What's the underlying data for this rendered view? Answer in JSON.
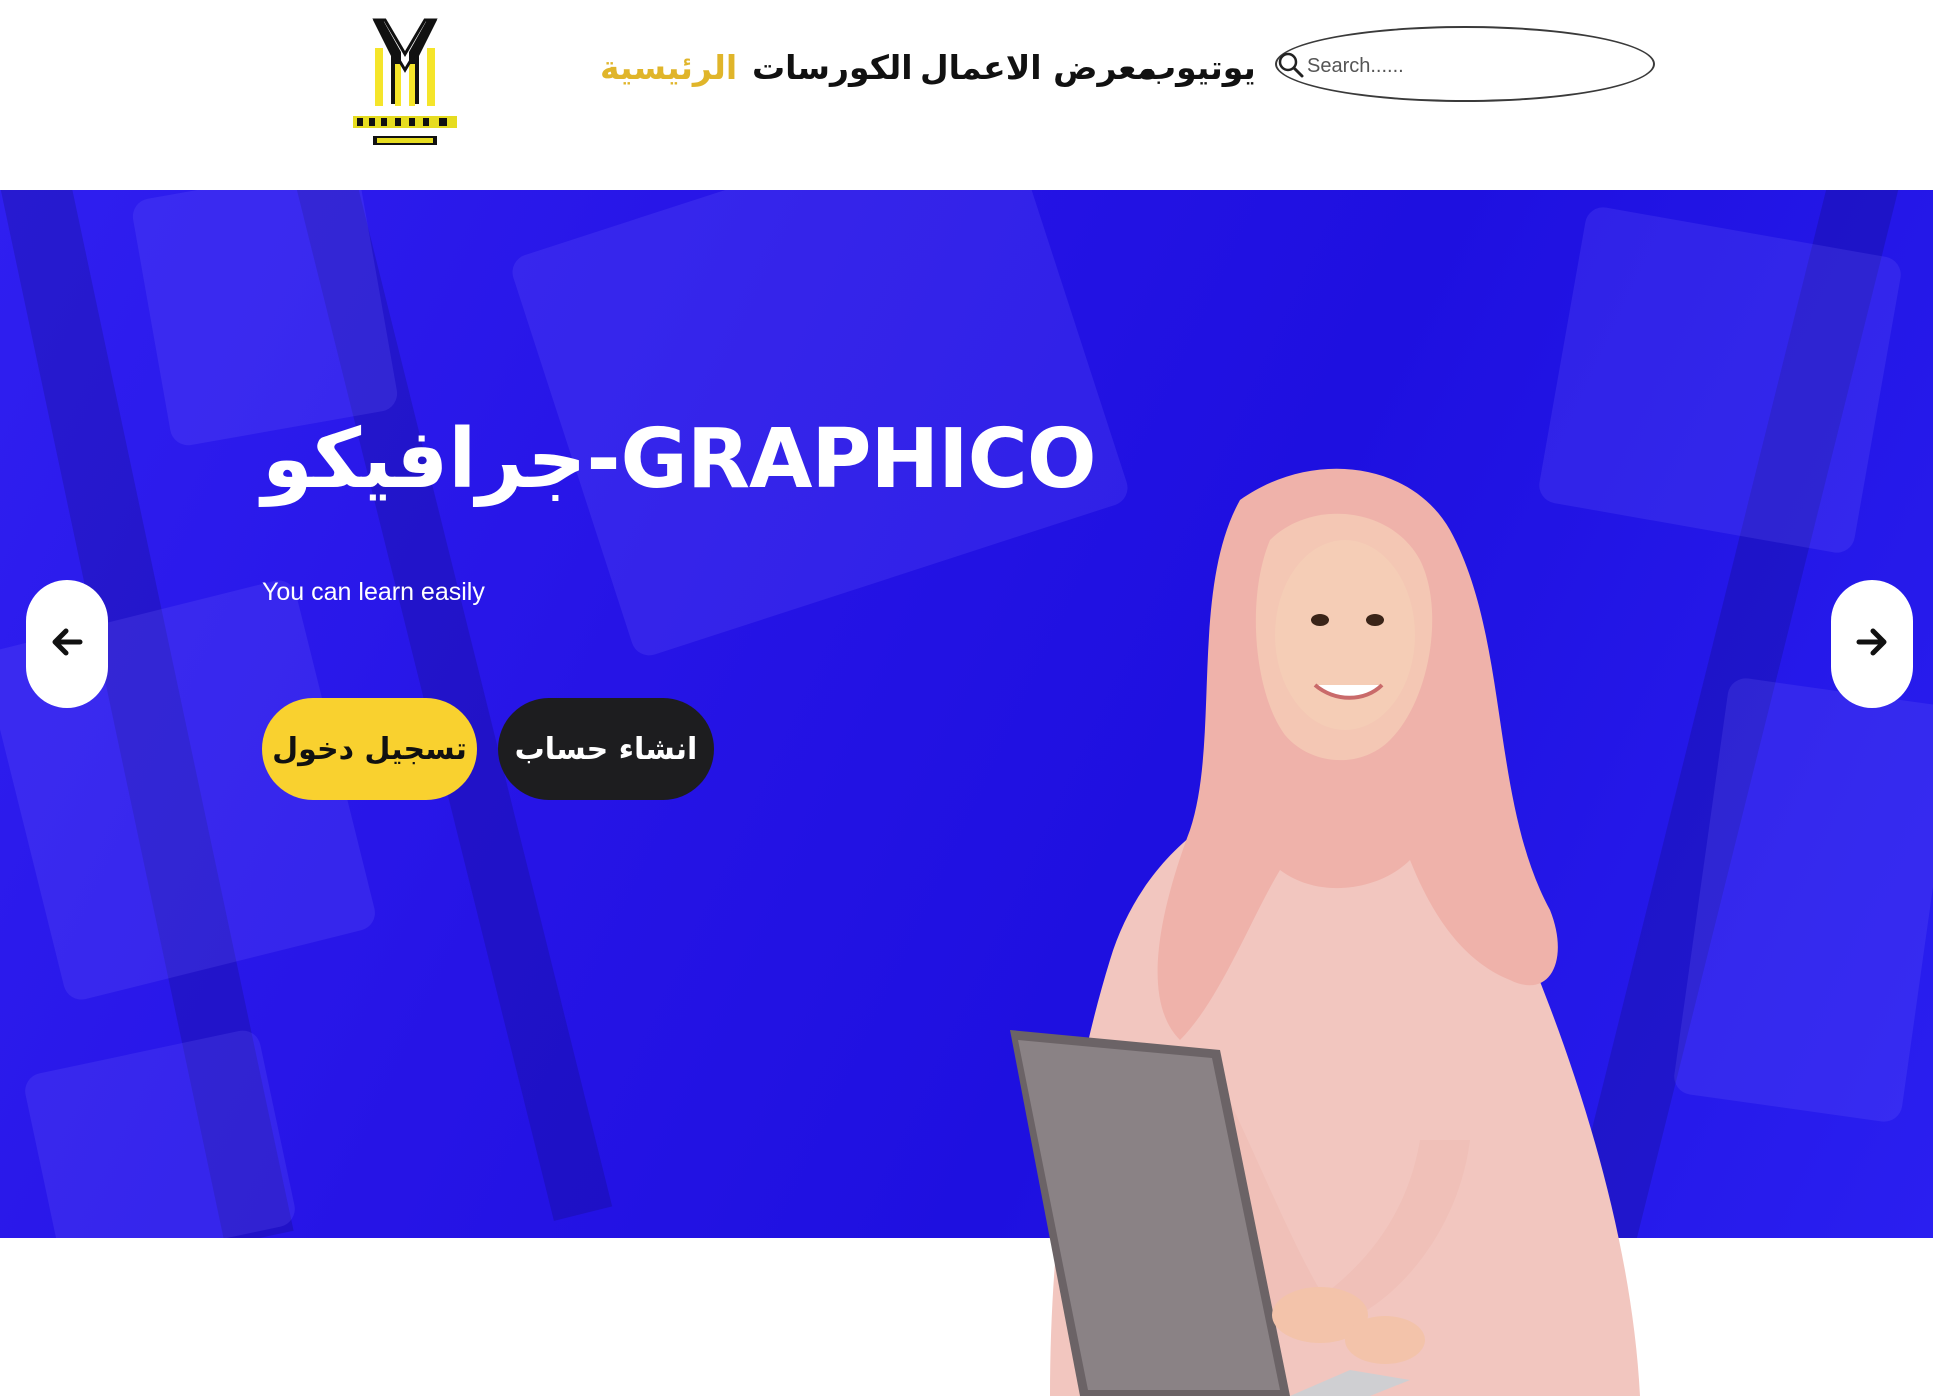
{
  "header": {
    "logo_name": "graphico-logo",
    "nav": [
      {
        "label": "الرئيسية",
        "active": true
      },
      {
        "label": "الكورسات",
        "active": false
      },
      {
        "label": "معرض الاعمال",
        "active": false
      },
      {
        "label": "يوتيوب",
        "active": false
      }
    ],
    "search": {
      "placeholder": "Search......",
      "value": "",
      "icon": "search-icon"
    }
  },
  "hero": {
    "title": "جرافيكو-GRAPHICO",
    "subtitle": "You can learn easily",
    "login_button": "تسجيل دخول",
    "register_button": "انشاء حساب",
    "prev_icon": "arrow-left-icon",
    "next_icon": "arrow-right-icon"
  },
  "colors": {
    "hero_bg": "#2614e6",
    "accent_yellow": "#f9d12f",
    "active_nav": "#e0b52a",
    "dark_button": "#1d1d1f"
  }
}
